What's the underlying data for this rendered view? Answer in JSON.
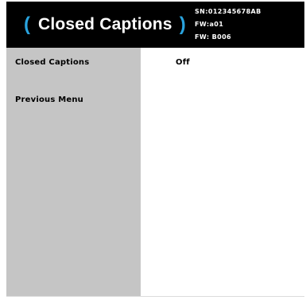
{
  "header": {
    "paren_left": "(",
    "title": "Closed Captions",
    "paren_right": ")",
    "serial": "SN:012345678AB",
    "fw_line1": "FW:a01",
    "fw_line2": "FW: B006",
    "accent_color": "#29a3de",
    "background_color": "#000000"
  },
  "menu": {
    "items": [
      {
        "label": "Closed Captions",
        "value": "Off",
        "selected": true
      },
      {
        "label": "Previous Menu"
      }
    ]
  },
  "colors": {
    "sidebar": "#c5c5c5",
    "content": "#ffffff"
  }
}
